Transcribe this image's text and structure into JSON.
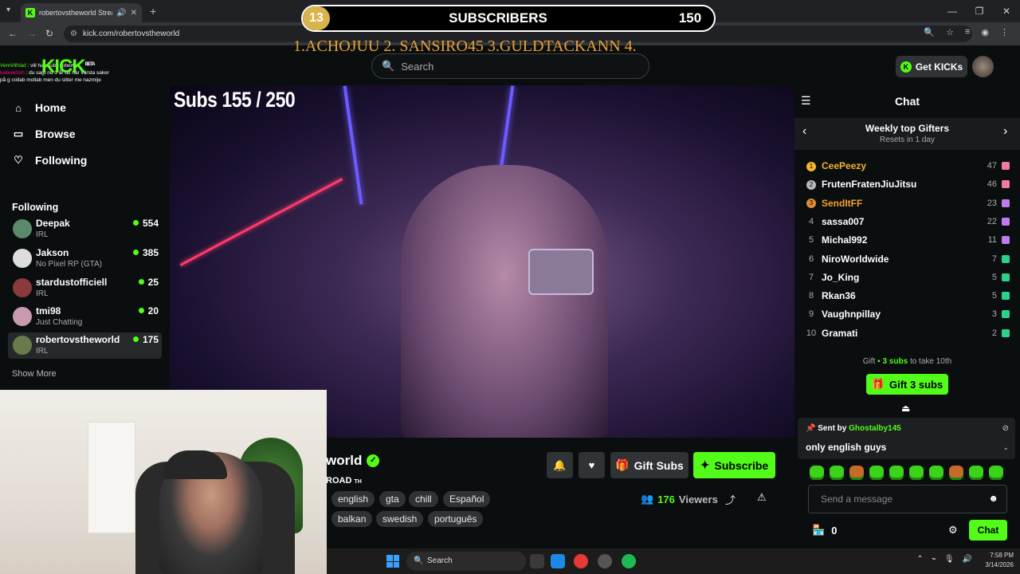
{
  "browser": {
    "tab_title": "robertovstheworld Stream",
    "url": "kick.com/robertovstheworld"
  },
  "overlay": {
    "sub_count": "13",
    "sub_label": "SUBSCRIBERS",
    "sub_goal": "150",
    "ticker": "1.ACHOJUU  2. SANSIRO45  3.GULDTACKANN  4.",
    "subs_progress": "Subs  155 / 250",
    "mini_chat": [
      {
        "user": "VemVillVad",
        "text": ": vill han subs roberto?"
      },
      {
        "user": "kalleekbsh",
        "text": ": du sagt nu 1 år du har värsta saker"
      },
      {
        "user": "",
        "text": "på g collab mollab men du sitter me nazmije"
      }
    ]
  },
  "header": {
    "logo": "KICK",
    "logo_badge": "BETA",
    "search_placeholder": "Search",
    "get_kicks": "Get KICKs"
  },
  "sidebar": {
    "nav": [
      {
        "label": "Home",
        "icon": "home-icon"
      },
      {
        "label": "Browse",
        "icon": "browse-icon"
      },
      {
        "label": "Following",
        "icon": "heart-icon"
      }
    ],
    "following_title": "Following",
    "channels": [
      {
        "name": "Deepak",
        "category": "IRL",
        "viewers": "554",
        "color": "#5b8a6a"
      },
      {
        "name": "Jakson",
        "category": "No Pixel RP (GTA)",
        "viewers": "385",
        "color": "#dddddd"
      },
      {
        "name": "stardustofficiell",
        "category": "IRL",
        "viewers": "25",
        "color": "#8a3a3a"
      },
      {
        "name": "tmi98",
        "category": "Just Chatting",
        "viewers": "20",
        "color": "#c89ab0"
      },
      {
        "name": "robertovstheworld",
        "category": "IRL",
        "viewers": "175",
        "color": "#6a7a4a"
      }
    ],
    "show_more": "Show More"
  },
  "stream": {
    "name_partial": "world",
    "title_partial": "ROAD",
    "title_suffix": "TH",
    "tags_row1": [
      "english",
      "gta",
      "chill",
      "Español"
    ],
    "tags_row2": [
      "balkan",
      "swedish",
      "português"
    ],
    "gift_subs": "Gift Subs",
    "subscribe": "Subscribe",
    "viewers": "176",
    "viewers_label": "Viewers"
  },
  "chat": {
    "title": "Chat",
    "gifters_title": "Weekly top Gifters",
    "gifters_reset": "Resets in 1 day",
    "gifters": [
      {
        "rank": "1",
        "name": "CeePeezy",
        "count": "47",
        "medal": "gold",
        "name_color": "#f5b52e"
      },
      {
        "rank": "2",
        "name": "FrutenFratenJiuJitsu",
        "count": "46",
        "medal": "silver",
        "name_color": "#ffffff"
      },
      {
        "rank": "3",
        "name": "SendItFF",
        "count": "23",
        "medal": "bronze",
        "name_color": "#f5a02e"
      },
      {
        "rank": "4",
        "name": "sassa007",
        "count": "22",
        "medal": "",
        "name_color": "#ffffff"
      },
      {
        "rank": "5",
        "name": "Michal992",
        "count": "11",
        "medal": "",
        "name_color": "#ffffff"
      },
      {
        "rank": "6",
        "name": "NiroWorldwide",
        "count": "7",
        "medal": "",
        "name_color": "#ffffff"
      },
      {
        "rank": "7",
        "name": "Jo_King",
        "count": "5",
        "medal": "",
        "name_color": "#ffffff"
      },
      {
        "rank": "8",
        "name": "Rkan36",
        "count": "5",
        "medal": "",
        "name_color": "#ffffff"
      },
      {
        "rank": "9",
        "name": "Vaughnpillay",
        "count": "3",
        "medal": "",
        "name_color": "#ffffff"
      },
      {
        "rank": "10",
        "name": "Gramati",
        "count": "2",
        "medal": "",
        "name_color": "#ffffff"
      }
    ],
    "gift_cta_prefix": "Gift",
    "gift_cta_amount": "3 subs",
    "gift_cta_suffix": "to take 10th",
    "gift_button": "Gift 3 subs",
    "pinned_label": "Sent by",
    "pinned_user": "Ghostalby145",
    "pinned_message": "only english guys",
    "input_placeholder": "Send a message",
    "kicks_balance": "0",
    "send_button": "Chat"
  },
  "taskbar": {
    "search": "Search",
    "time": "7:58 PM",
    "date": "3/14/2026"
  },
  "colors": {
    "accent": "#53fc18",
    "bg": "#0b0e0f",
    "panel": "#2f3336"
  }
}
